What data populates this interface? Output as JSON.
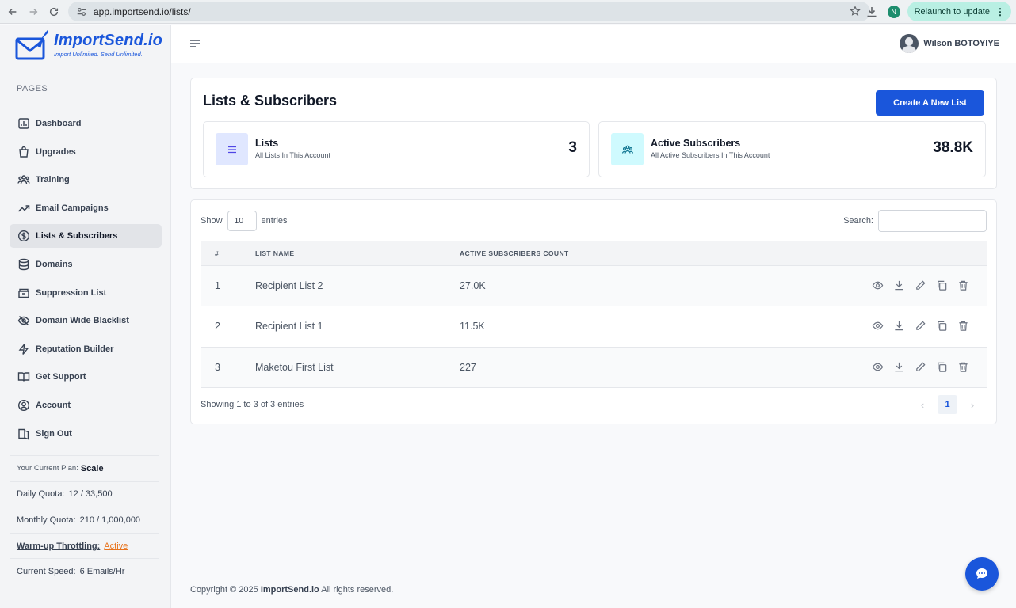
{
  "browser": {
    "url": "app.importsend.io/lists/",
    "profile_initial": "N",
    "relaunch_label": "Relaunch to update"
  },
  "brand": {
    "name": "ImportSend.io",
    "tagline": "Import Unlimited. Send Unlimited."
  },
  "sidebar": {
    "section_label": "PAGES",
    "items": [
      {
        "label": "Dashboard",
        "icon": "chart-icon"
      },
      {
        "label": "Upgrades",
        "icon": "shopping-bag-icon"
      },
      {
        "label": "Training",
        "icon": "users-icon"
      },
      {
        "label": "Email Campaigns",
        "icon": "trending-up-icon"
      },
      {
        "label": "Lists & Subscribers",
        "icon": "dollar-circle-icon",
        "active": true
      },
      {
        "label": "Domains",
        "icon": "database-icon"
      },
      {
        "label": "Suppression List",
        "icon": "archive-icon"
      },
      {
        "label": "Domain Wide Blacklist",
        "icon": "eye-off-icon"
      },
      {
        "label": "Reputation Builder",
        "icon": "lightning-icon"
      },
      {
        "label": "Get Support",
        "icon": "book-icon"
      },
      {
        "label": "Account",
        "icon": "user-circle-icon"
      },
      {
        "label": "Sign Out",
        "icon": "logout-icon"
      }
    ],
    "plan": {
      "plan_label": "Your Current Plan:",
      "plan_value": "Scale",
      "daily_label": "Daily Quota:",
      "daily_value": "12 / 33,500",
      "monthly_label": "Monthly Quota:",
      "monthly_value": "210 / 1,000,000",
      "warmup_label": "Warm-up Throttling:",
      "warmup_value": "Active",
      "speed_label": "Current Speed:",
      "speed_value": "6 Emails/Hr"
    }
  },
  "topbar": {
    "user_name": "Wilson BOTOYIYE"
  },
  "header": {
    "title": "Lists & Subscribers",
    "create_button": "Create A New List"
  },
  "stats": [
    {
      "title": "Lists",
      "subtitle": "All Lists In This Account",
      "value": "3",
      "icon": "list-icon"
    },
    {
      "title": "Active Subscribers",
      "subtitle": "All Active Subscribers In This Account",
      "value": "38.8K",
      "icon": "users-icon"
    }
  ],
  "table": {
    "show_label": "Show",
    "entries_value": "10",
    "entries_label": "entries",
    "search_label": "Search:",
    "columns": [
      "#",
      "LIST NAME",
      "ACTIVE SUBSCRIBERS COUNT"
    ],
    "rows": [
      {
        "num": "1",
        "name": "Recipient List 2",
        "count": "27.0K"
      },
      {
        "num": "2",
        "name": "Recipient List 1",
        "count": "11.5K"
      },
      {
        "num": "3",
        "name": "Maketou First List",
        "count": "227"
      }
    ],
    "actions": [
      "eye-icon",
      "download-icon",
      "edit-icon",
      "copy-icon",
      "trash-icon"
    ],
    "showing_text": "Showing 1 to 3 of 3 entries",
    "pagination": {
      "prev": "‹",
      "current": "1",
      "next": "›"
    }
  },
  "footer": {
    "prefix": "Copyright © 2025",
    "brand": "ImportSend.io",
    "suffix": "All rights reserved."
  },
  "colors": {
    "primary": "#1a56db",
    "warning": "#e8731c",
    "relaunch_bg": "#b9efe3"
  }
}
